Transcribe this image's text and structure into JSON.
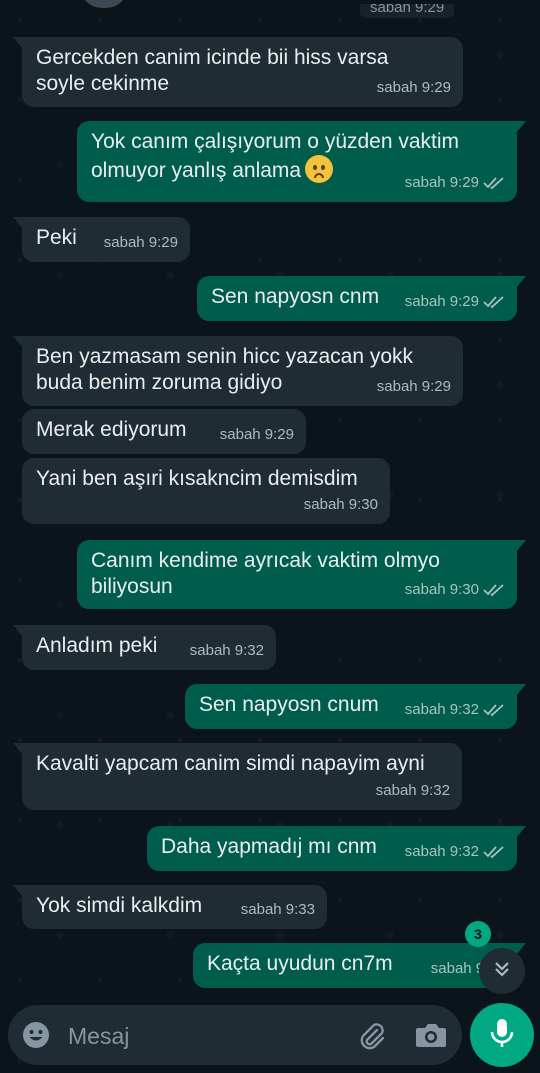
{
  "top": {
    "partial_date": "sabah 9:29"
  },
  "messages": [
    {
      "dir": "in",
      "text": "Gercekden canim icinde bii hiss varsa\nsoyle cekinme",
      "time": "sabah 9:29"
    },
    {
      "dir": "out",
      "text": "Yok canım çalışıyorum o yüzden vaktim\nolmuyor yanlış anlama",
      "emoji": "worried-face",
      "time": "sabah 9:29",
      "status": "read"
    },
    {
      "dir": "in",
      "text": "Peki",
      "time": "sabah 9:29"
    },
    {
      "dir": "out",
      "text": "Sen napyosn cnm",
      "time": "sabah 9:29",
      "status": "read"
    },
    {
      "dir": "in",
      "text": "Ben yazmasam senin hicc yazacan yokk\nbuda benim zoruma gidiyo",
      "time": "sabah 9:29"
    },
    {
      "dir": "in",
      "text": "Merak ediyorum",
      "time": "sabah 9:29"
    },
    {
      "dir": "in",
      "text": "Yani ben aşıri kısakncim demisdim",
      "time": "sabah 9:30"
    },
    {
      "dir": "out",
      "text": "Canım kendime ayrıcak vaktim olmyo\nbiliyosun",
      "time": "sabah 9:30",
      "status": "read"
    },
    {
      "dir": "in",
      "text": "Anladım peki",
      "time": "sabah 9:32"
    },
    {
      "dir": "out",
      "text": "Sen napyosn cnum",
      "time": "sabah 9:32",
      "status": "read"
    },
    {
      "dir": "in",
      "text": "Kavalti yapcam canim simdi napayim ayni",
      "time": "sabah 9:32"
    },
    {
      "dir": "out",
      "text": "Daha yapmadıj mı cnm",
      "time": "sabah 9:32",
      "status": "read"
    },
    {
      "dir": "in",
      "text": "Yok simdi kalkdim",
      "time": "sabah 9:33"
    },
    {
      "dir": "out",
      "text": "Kaçta uyudun cn7m",
      "time": "sabah 9:33",
      "status": "sent"
    }
  ],
  "scroll_button": {
    "unread_count": "3",
    "icon": "double-chevron-down-icon"
  },
  "input": {
    "placeholder": "Mesaj",
    "emoji_icon": "emoji-icon",
    "attach_icon": "paperclip-icon",
    "camera_icon": "camera-icon",
    "mic_icon": "microphone-icon"
  },
  "colors": {
    "background": "#0b141a",
    "incoming_bubble": "#202c33",
    "outgoing_bubble": "#005c4b",
    "accent": "#00a884",
    "read_ticks": "#a7c4bd"
  }
}
